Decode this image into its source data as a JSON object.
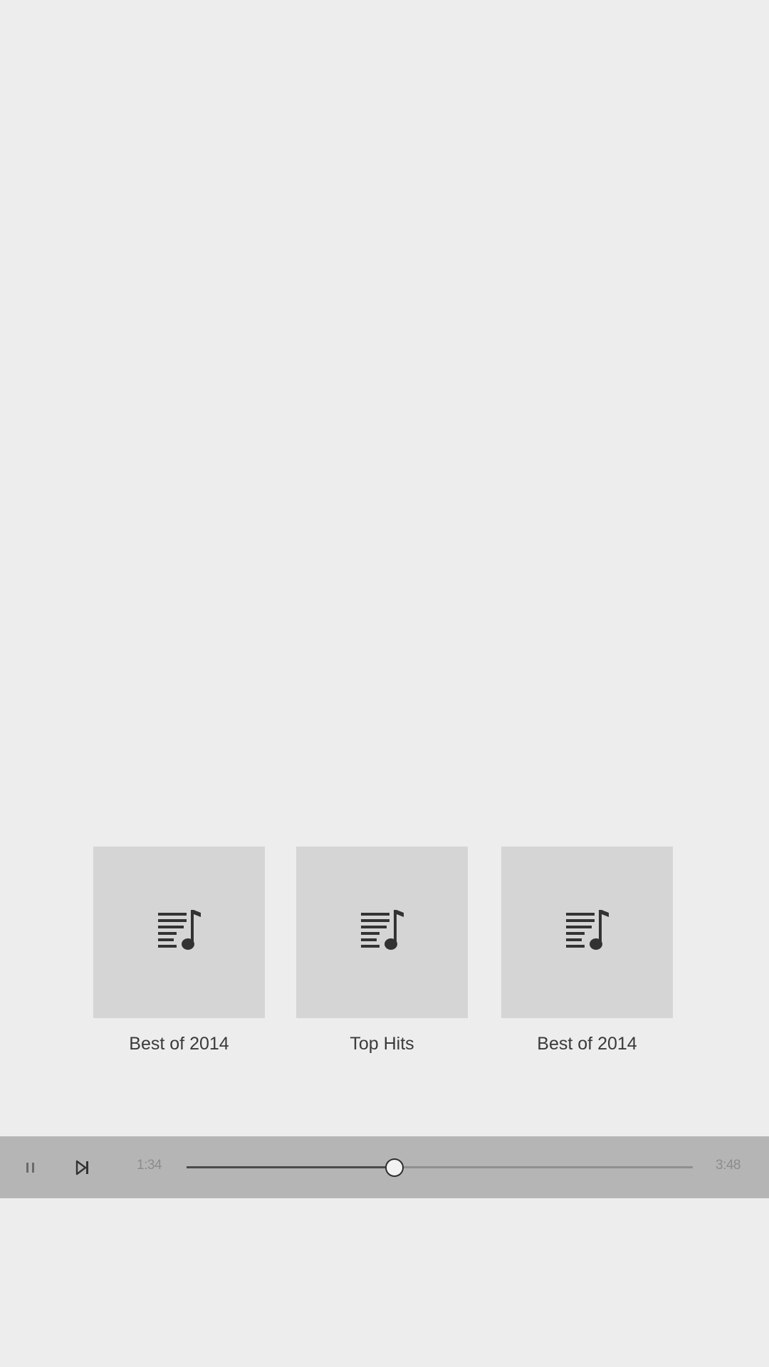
{
  "playlists": [
    {
      "title": "Best of 2014",
      "icon": "playlist-music-icon"
    },
    {
      "title": "Top Hits",
      "icon": "playlist-music-icon"
    },
    {
      "title": "Best of 2014",
      "icon": "playlist-music-icon"
    }
  ],
  "player": {
    "pause_icon": "pause-icon",
    "next_icon": "skip-next-icon",
    "elapsed": "1:34",
    "total": "3:48",
    "progress": 0.41
  },
  "colors": {
    "background": "#ededee",
    "tile": "#d5d5d5",
    "player_bar": "#b5b5b5",
    "icon": "#333333"
  }
}
